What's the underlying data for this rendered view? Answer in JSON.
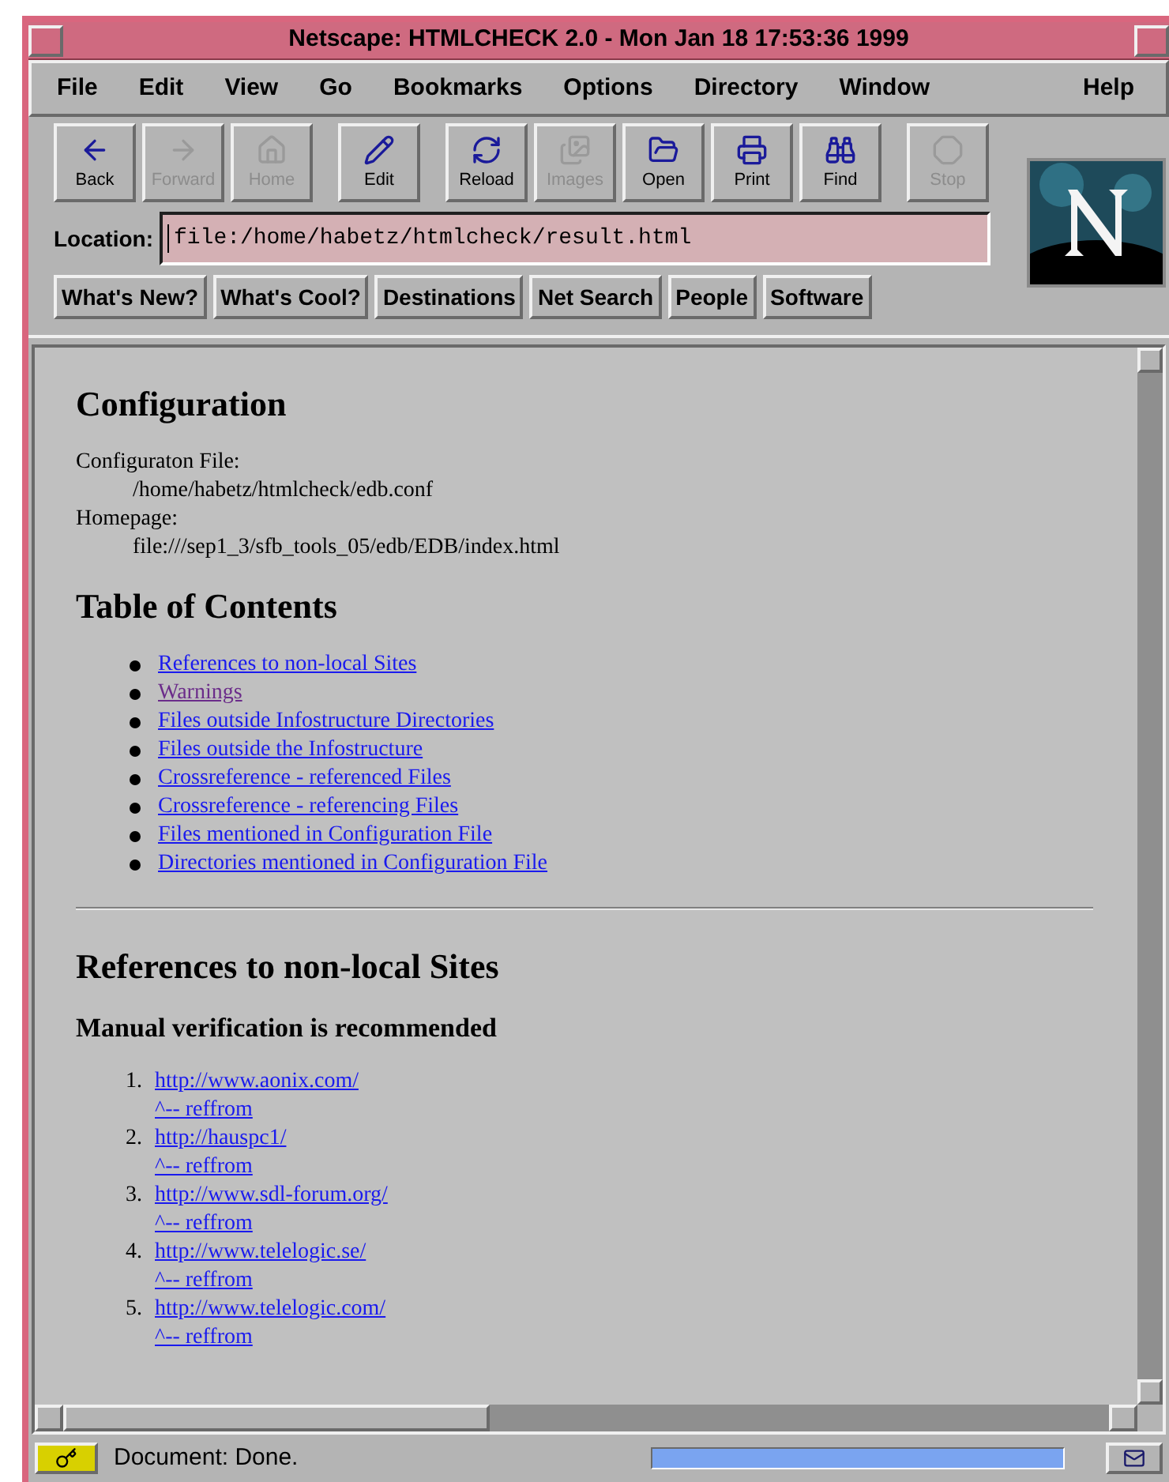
{
  "window": {
    "title": "Netscape: HTMLCHECK 2.0 - Mon Jan 18 17:53:36 1999"
  },
  "menu": [
    "File",
    "Edit",
    "View",
    "Go",
    "Bookmarks",
    "Options",
    "Directory",
    "Window"
  ],
  "menu_help": "Help",
  "toolbar": [
    {
      "kind": "back",
      "label": "Back",
      "disabled": false
    },
    {
      "kind": "forward",
      "label": "Forward",
      "disabled": true
    },
    {
      "kind": "home",
      "label": "Home",
      "disabled": true
    },
    {
      "kind": "edit",
      "label": "Edit",
      "disabled": false
    },
    {
      "kind": "reload",
      "label": "Reload",
      "disabled": false
    },
    {
      "kind": "images",
      "label": "Images",
      "disabled": true
    },
    {
      "kind": "open",
      "label": "Open",
      "disabled": false
    },
    {
      "kind": "print",
      "label": "Print",
      "disabled": false
    },
    {
      "kind": "find",
      "label": "Find",
      "disabled": false
    },
    {
      "kind": "stop",
      "label": "Stop",
      "disabled": true
    }
  ],
  "location": {
    "label": "Location:",
    "value": "file:/home/habetz/htmlcheck/result.html"
  },
  "directory_buttons": [
    "What's New?",
    "What's Cool?",
    "Destinations",
    "Net Search",
    "People",
    "Software"
  ],
  "page": {
    "heading_1": "Configuration",
    "config": [
      {
        "label": "Configuraton File:",
        "value": "/home/habetz/htmlcheck/edb.conf"
      },
      {
        "label": "Homepage:",
        "value": "file:///sep1_3/sfb_tools_05/edb/EDB/index.html"
      }
    ],
    "heading_2": "Table of Contents",
    "toc": [
      {
        "text": "References to non-local Sites",
        "visited": false
      },
      {
        "text": "Warnings",
        "visited": true
      },
      {
        "text": "Files outside Infostructure Directories",
        "visited": false
      },
      {
        "text": "Files outside the Infostructure",
        "visited": false
      },
      {
        "text": "Crossreference - referenced Files",
        "visited": false
      },
      {
        "text": "Crossreference - referencing Files",
        "visited": false
      },
      {
        "text": "Files mentioned in Configuration File",
        "visited": false
      },
      {
        "text": "Directories mentioned in Configuration File",
        "visited": false
      }
    ],
    "heading_3": "References to non-local Sites",
    "subheading": "Manual verification is recommended",
    "references": [
      {
        "number": "1.",
        "url": "http://www.aonix.com/",
        "reffrom": "^-- reffrom"
      },
      {
        "number": "2.",
        "url": "http://hauspc1/",
        "reffrom": "^-- reffrom"
      },
      {
        "number": "3.",
        "url": "http://www.sdl-forum.org/",
        "reffrom": "^-- reffrom"
      },
      {
        "number": "4.",
        "url": "http://www.telelogic.se/",
        "reffrom": "^-- reffrom"
      },
      {
        "number": "5.",
        "url": "http://www.telelogic.com/",
        "reffrom": "^-- reffrom"
      }
    ]
  },
  "status_bar": {
    "text": "Document: Done.",
    "progress": {
      "level": 1
    }
  }
}
